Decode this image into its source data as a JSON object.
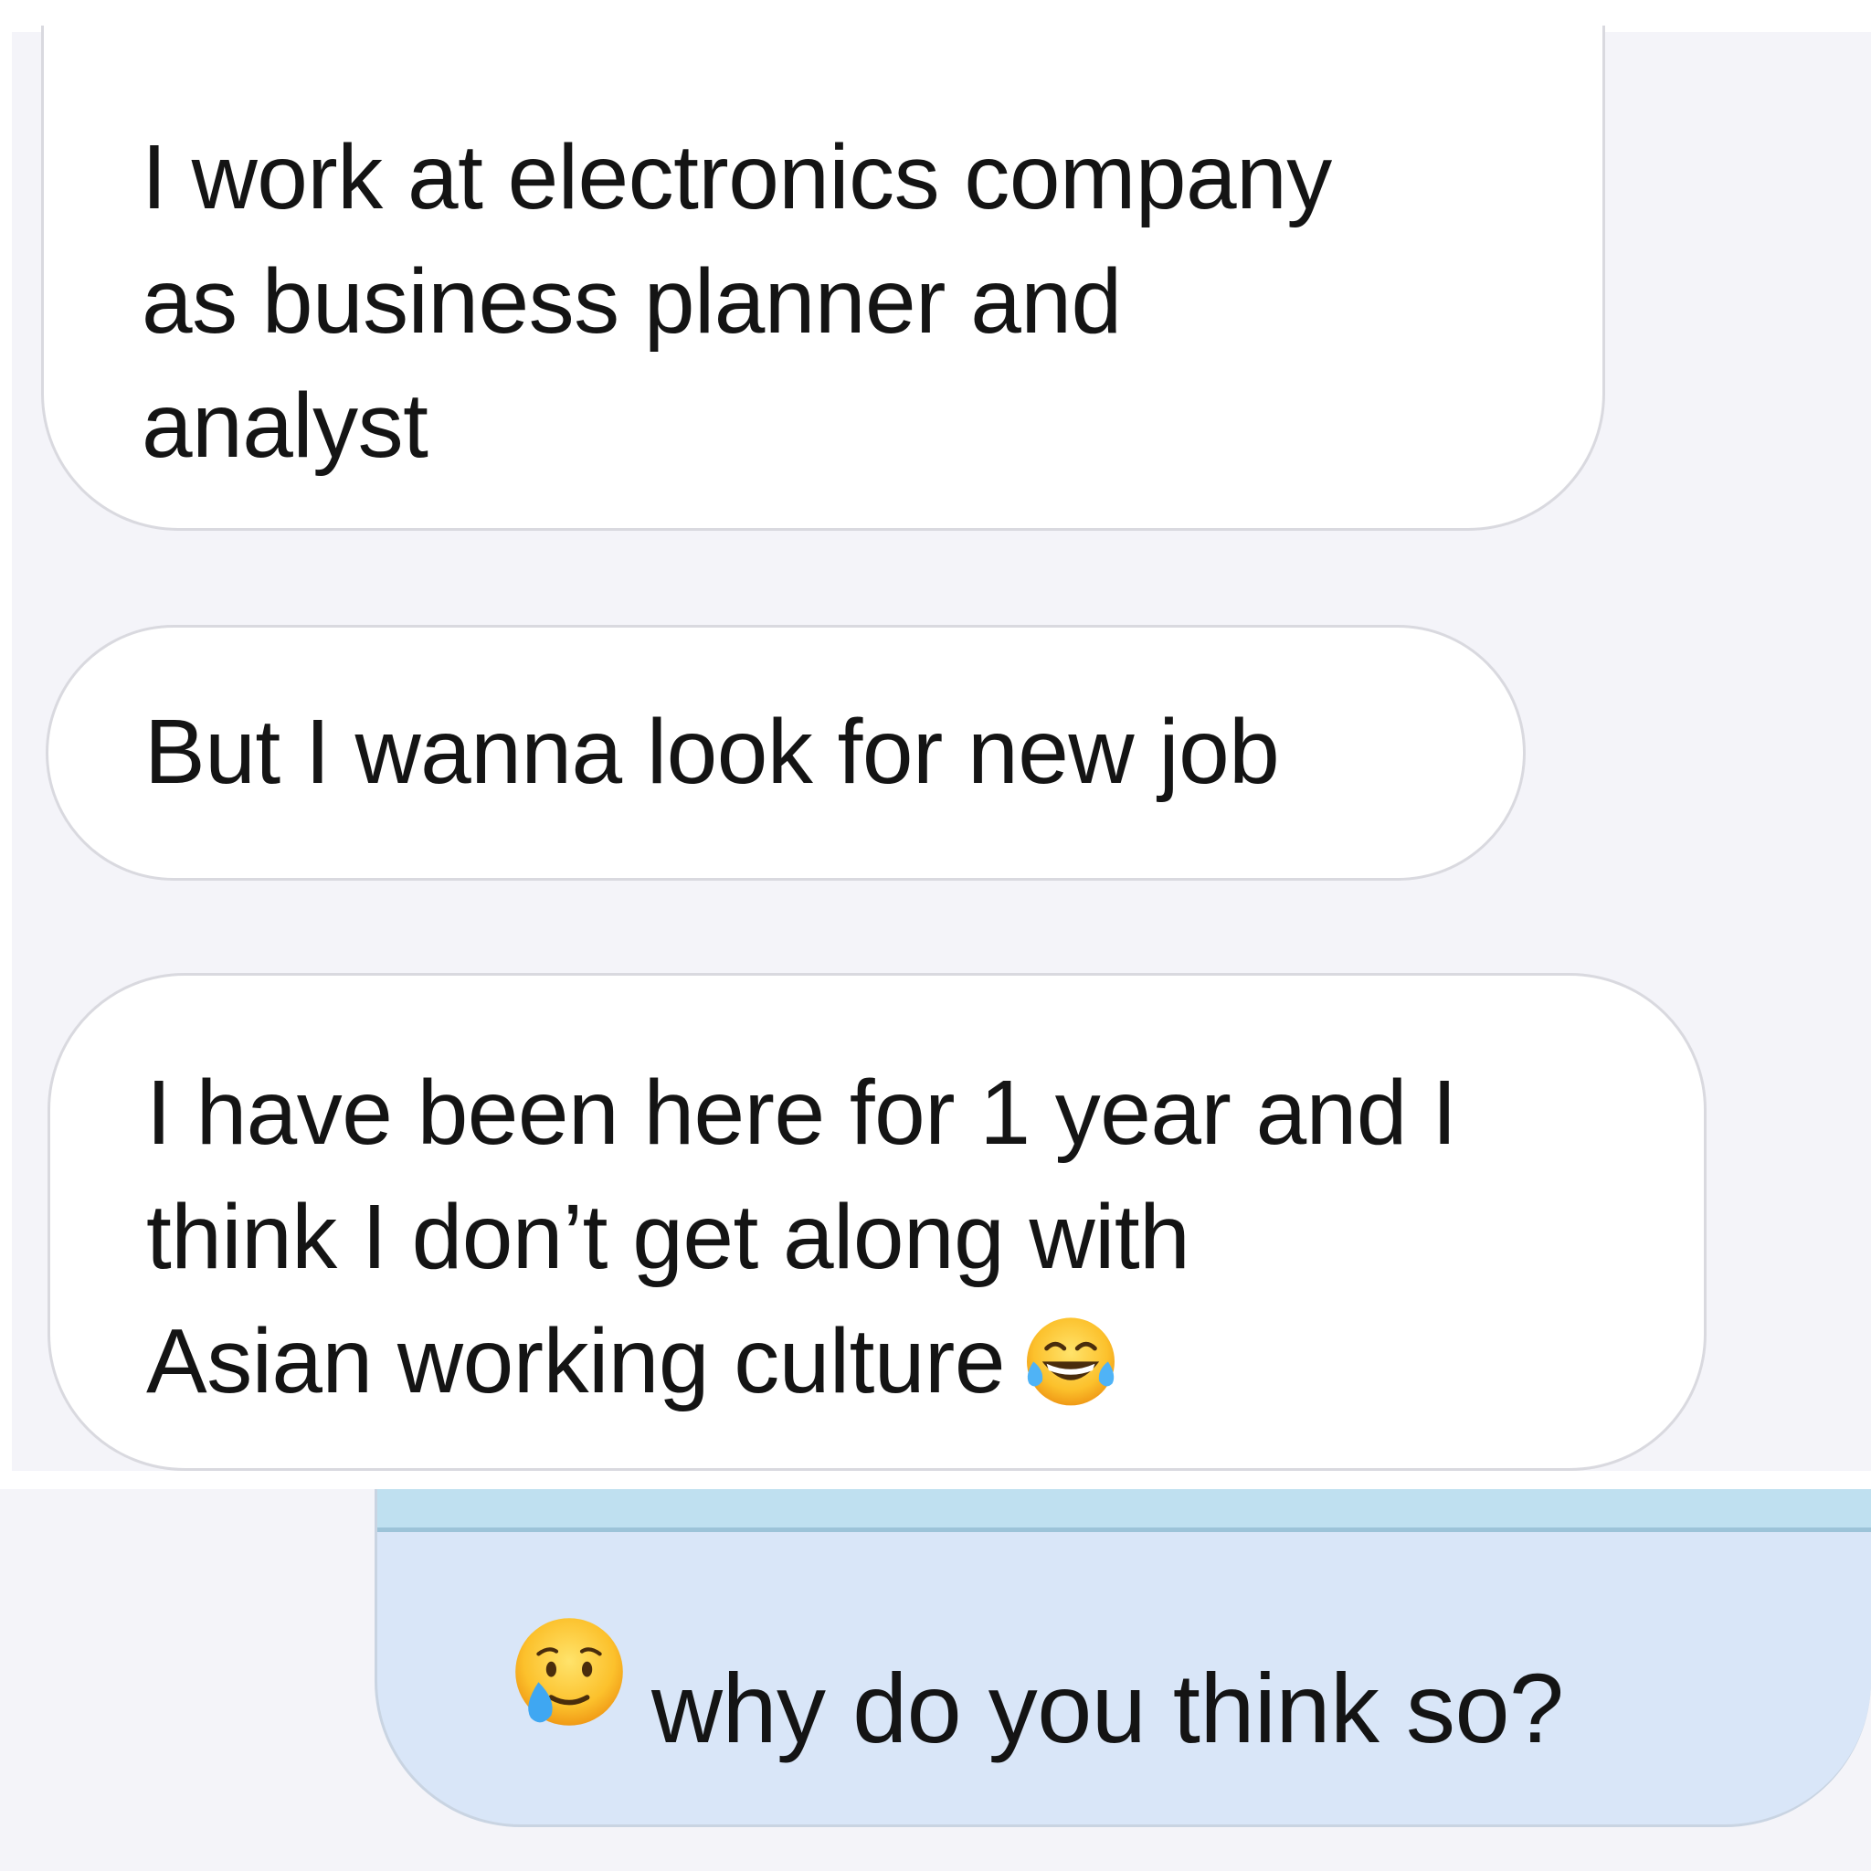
{
  "messages": [
    {
      "id": "received-1",
      "direction": "incoming",
      "lines": [
        "I work at electronics company",
        "as business planner and",
        "analyst"
      ]
    },
    {
      "id": "received-2",
      "direction": "incoming",
      "lines": [
        "But I wanna look for new job"
      ]
    },
    {
      "id": "received-3",
      "direction": "incoming",
      "lines": [
        "I have been here for 1 year and I",
        "think I don’t get along with",
        "Asian working culture"
      ],
      "trailing_emoji": "face-with-tears-of-joy-icon"
    },
    {
      "id": "sent-1",
      "direction": "outgoing",
      "leading_emoji": "sad-relieved-face-with-tear-icon",
      "text": "why do you think so?"
    }
  ],
  "colors": {
    "background": "#f4f4f9",
    "incoming_bubble": "#ffffff",
    "outgoing_bubble": "#d9e6f8",
    "text": "#141414"
  }
}
